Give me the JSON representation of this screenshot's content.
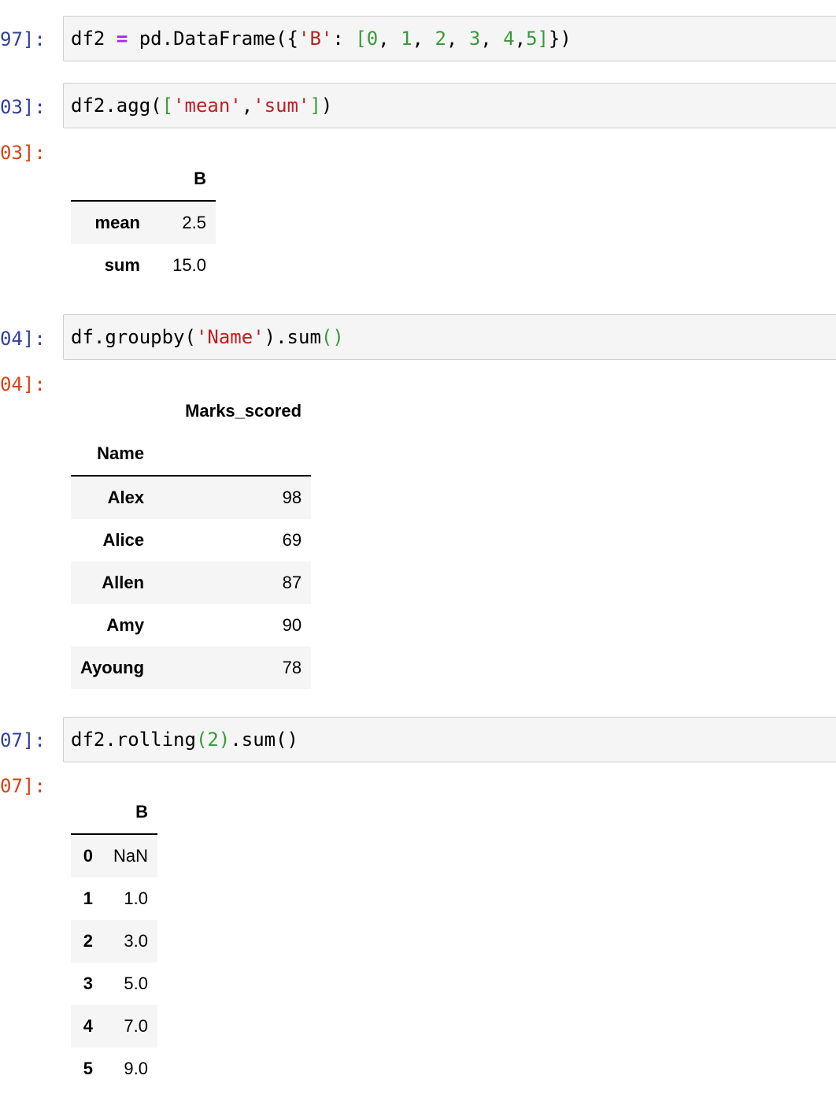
{
  "cells": [
    {
      "in_prompt": "97]:",
      "code_tokens": [
        {
          "t": "df2",
          "c": "var"
        },
        {
          "t": " ",
          "c": "p"
        },
        {
          "t": "=",
          "c": "op"
        },
        {
          "t": " pd.DataFrame({",
          "c": "p"
        },
        {
          "t": "'B'",
          "c": "str"
        },
        {
          "t": ": ",
          "c": "p"
        },
        {
          "t": "[",
          "c": "br"
        },
        {
          "t": "0",
          "c": "num"
        },
        {
          "t": ", ",
          "c": "p"
        },
        {
          "t": "1",
          "c": "num"
        },
        {
          "t": ", ",
          "c": "p"
        },
        {
          "t": "2",
          "c": "num"
        },
        {
          "t": ", ",
          "c": "p"
        },
        {
          "t": "3",
          "c": "num"
        },
        {
          "t": ", ",
          "c": "p"
        },
        {
          "t": "4",
          "c": "num"
        },
        {
          "t": ",",
          "c": "p"
        },
        {
          "t": "5",
          "c": "num"
        },
        {
          "t": "]",
          "c": "br"
        },
        {
          "t": "})",
          "c": "p"
        }
      ]
    },
    {
      "in_prompt": "03]:",
      "out_prompt": "03]:",
      "code_tokens": [
        {
          "t": "df2.agg(",
          "c": "p"
        },
        {
          "t": "[",
          "c": "br"
        },
        {
          "t": "'mean'",
          "c": "str"
        },
        {
          "t": ",",
          "c": "p"
        },
        {
          "t": "'sum'",
          "c": "str"
        },
        {
          "t": "]",
          "c": "br"
        },
        {
          "t": ")",
          "c": "p"
        }
      ],
      "output": {
        "columns": [
          "B"
        ],
        "rows": [
          {
            "index": "mean",
            "values": [
              "2.5"
            ]
          },
          {
            "index": "sum",
            "values": [
              "15.0"
            ]
          }
        ]
      }
    },
    {
      "in_prompt": "04]:",
      "out_prompt": "04]:",
      "code_tokens": [
        {
          "t": "df.groupby(",
          "c": "p"
        },
        {
          "t": "'Name'",
          "c": "str"
        },
        {
          "t": ").sum",
          "c": "p"
        },
        {
          "t": "()",
          "c": "br"
        }
      ],
      "output": {
        "columns": [
          "Marks_scored"
        ],
        "index_name": "Name",
        "rows": [
          {
            "index": "Alex",
            "values": [
              "98"
            ]
          },
          {
            "index": "Alice",
            "values": [
              "69"
            ]
          },
          {
            "index": "Allen",
            "values": [
              "87"
            ]
          },
          {
            "index": "Amy",
            "values": [
              "90"
            ]
          },
          {
            "index": "Ayoung",
            "values": [
              "78"
            ]
          }
        ]
      }
    },
    {
      "in_prompt": "07]:",
      "out_prompt": "07]:",
      "code_tokens": [
        {
          "t": "df2.rolling",
          "c": "p"
        },
        {
          "t": "(",
          "c": "br"
        },
        {
          "t": "2",
          "c": "num"
        },
        {
          "t": ")",
          "c": "br"
        },
        {
          "t": ".sum()",
          "c": "p"
        }
      ],
      "output": {
        "columns": [
          "B"
        ],
        "rows": [
          {
            "index": "0",
            "values": [
              "NaN"
            ]
          },
          {
            "index": "1",
            "values": [
              "1.0"
            ]
          },
          {
            "index": "2",
            "values": [
              "3.0"
            ]
          },
          {
            "index": "3",
            "values": [
              "5.0"
            ]
          },
          {
            "index": "4",
            "values": [
              "7.0"
            ]
          },
          {
            "index": "5",
            "values": [
              "9.0"
            ]
          }
        ]
      }
    }
  ],
  "colors": {
    "in_prompt": "#303f9f",
    "out_prompt": "#d84315",
    "string": "#ba2121",
    "number": "#3a9a3a",
    "operator": "#aa22ff",
    "input_bg": "#f5f5f5"
  }
}
